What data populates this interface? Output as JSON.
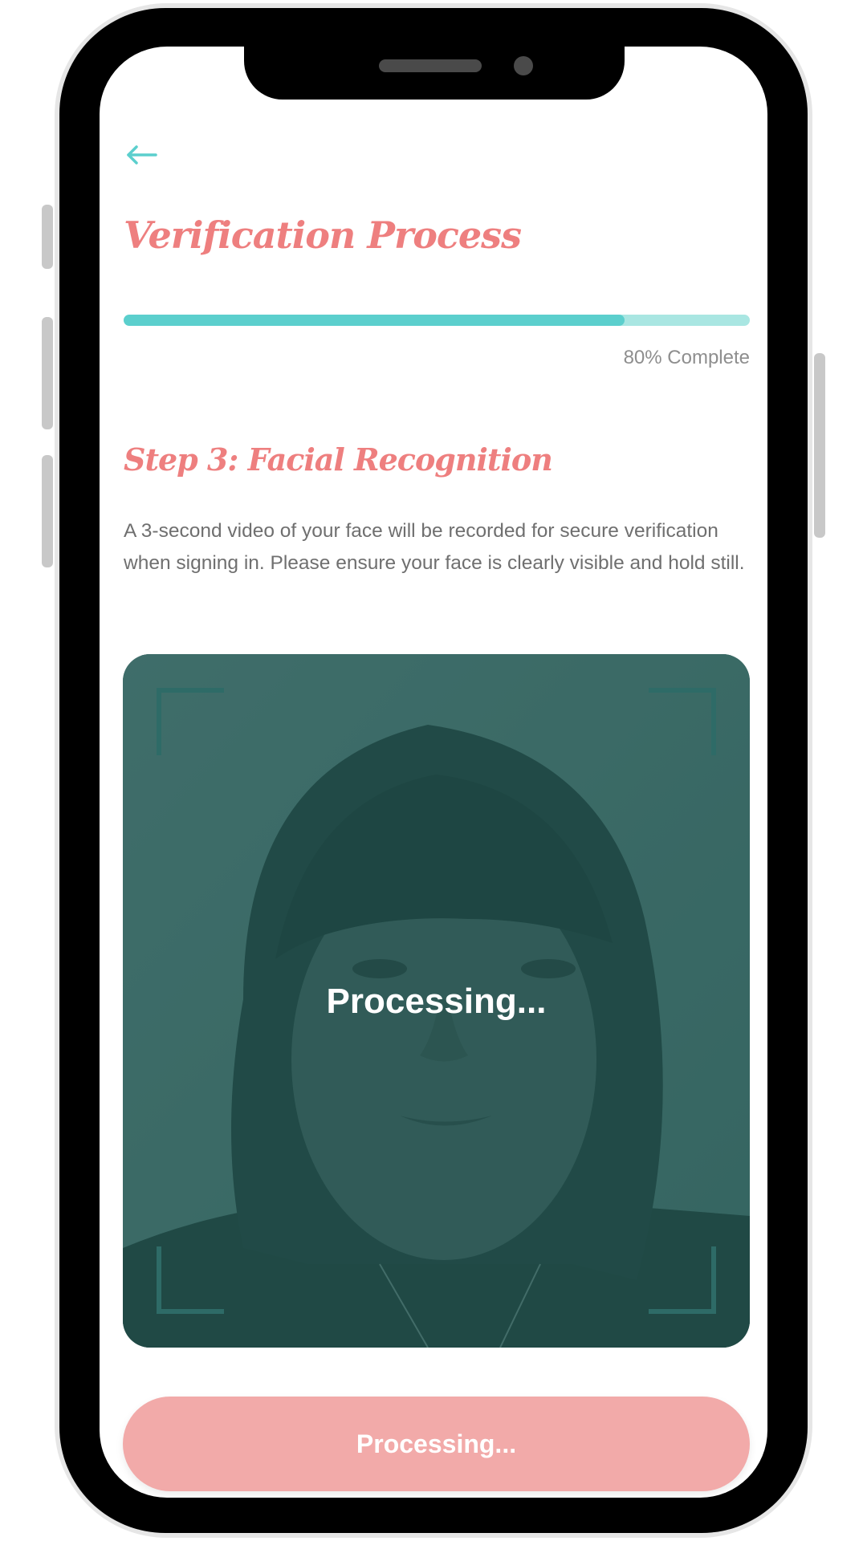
{
  "header": {
    "back_icon": "arrow-left-icon",
    "title": "Verification Process"
  },
  "progress": {
    "percent": 80,
    "label": "80% Complete"
  },
  "step": {
    "title": "Step 3: Facial Recognition",
    "description": "A 3-second video of your face will be recorded for secure verification when signing in. Please ensure your face is clearly visible and hold still."
  },
  "camera": {
    "status_text": "Processing..."
  },
  "actions": {
    "primary_label": "Processing...",
    "primary_disabled": true
  },
  "colors": {
    "accent_teal": "#5bcfcd",
    "track_teal": "#a9e6e2",
    "title_coral": "#ee7f7f",
    "button_coral": "#f2aaa9"
  }
}
